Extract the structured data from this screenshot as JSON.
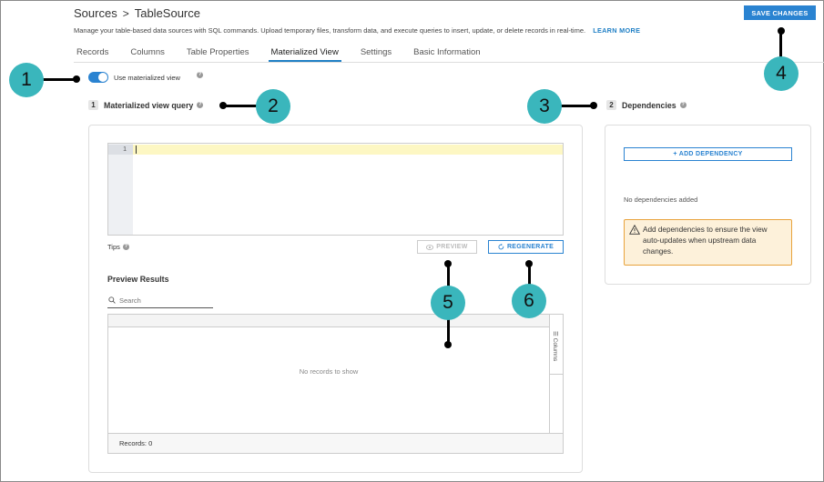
{
  "header": {
    "breadcrumb_root": "Sources",
    "breadcrumb_sep": ">",
    "breadcrumb_current": "TableSource",
    "description": "Manage your table-based data sources with SQL commands. Upload temporary files, transform data, and execute queries to insert, update, or delete records in real-time.",
    "learn_more": "LEARN MORE",
    "save_label": "SAVE CHANGES"
  },
  "tabs": [
    {
      "label": "Records"
    },
    {
      "label": "Columns"
    },
    {
      "label": "Table Properties"
    },
    {
      "label": "Materialized View",
      "active": true
    },
    {
      "label": "Settings"
    },
    {
      "label": "Basic Information"
    }
  ],
  "toggle": {
    "label": "Use materialized view",
    "on": true
  },
  "query_section": {
    "number": "1",
    "title": "Materialized view query",
    "line_number": "1",
    "tips_label": "Tips",
    "preview_label": "PREVIEW",
    "regenerate_label": "REGENERATE"
  },
  "preview": {
    "title": "Preview Results",
    "search_placeholder": "Search",
    "empty_text": "No records to show",
    "columns_label": "Columns",
    "records_label": "Records: 0"
  },
  "dependencies": {
    "number": "2",
    "title": "Dependencies",
    "add_label": "+ ADD DEPENDENCY",
    "empty_text": "No dependencies added",
    "warning_text": "Add dependencies to ensure the view auto-updates when upstream data changes."
  },
  "callouts": [
    "1",
    "2",
    "3",
    "4",
    "5",
    "6"
  ],
  "colors": {
    "accent": "#2a83d1",
    "callout": "#3ab6bc",
    "warning_bg": "#fdf1da",
    "warning_border": "#e8a33c"
  },
  "icons": [
    "help-icon",
    "search-icon",
    "eye-icon",
    "refresh-icon",
    "warning-icon",
    "columns-icon"
  ]
}
